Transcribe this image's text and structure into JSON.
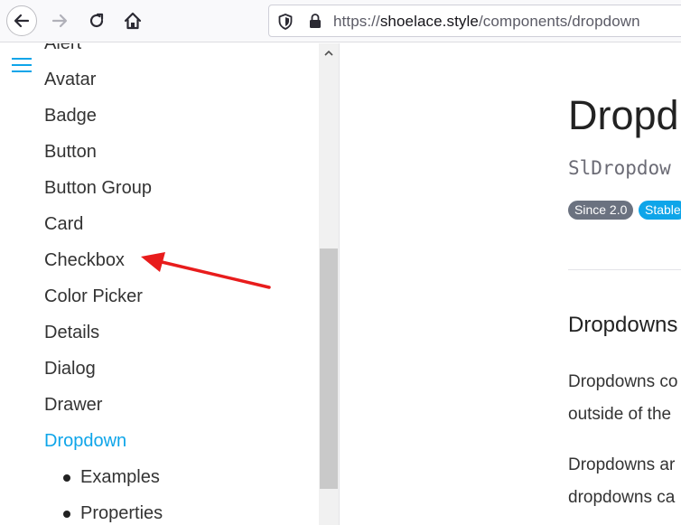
{
  "browser": {
    "url_scheme": "https://",
    "url_host": "shoelace.style",
    "url_path": "/components/dropdown"
  },
  "sidebar": {
    "items": [
      {
        "label": "Alert"
      },
      {
        "label": "Avatar"
      },
      {
        "label": "Badge"
      },
      {
        "label": "Button"
      },
      {
        "label": "Button Group"
      },
      {
        "label": "Card"
      },
      {
        "label": "Checkbox"
      },
      {
        "label": "Color Picker"
      },
      {
        "label": "Details"
      },
      {
        "label": "Dialog"
      },
      {
        "label": "Drawer"
      },
      {
        "label": "Dropdown",
        "active": true
      }
    ],
    "subitems": [
      {
        "label": "Examples"
      },
      {
        "label": "Properties"
      }
    ],
    "accent_color": "#0ea5e9"
  },
  "content": {
    "title": "Dropd",
    "class_name": "SlDropdow",
    "badges": {
      "since": "Since 2.0",
      "stable": "Stable"
    },
    "section_heading": "Dropdowns",
    "paragraph1_line1": "Dropdowns co",
    "paragraph1_line2": "outside of the",
    "paragraph2_line1": "Dropdowns ar",
    "paragraph2_line2": "dropdowns ca",
    "paragraph2_line3": "..."
  },
  "annotation": {
    "arrow_color": "#e81c1c"
  }
}
